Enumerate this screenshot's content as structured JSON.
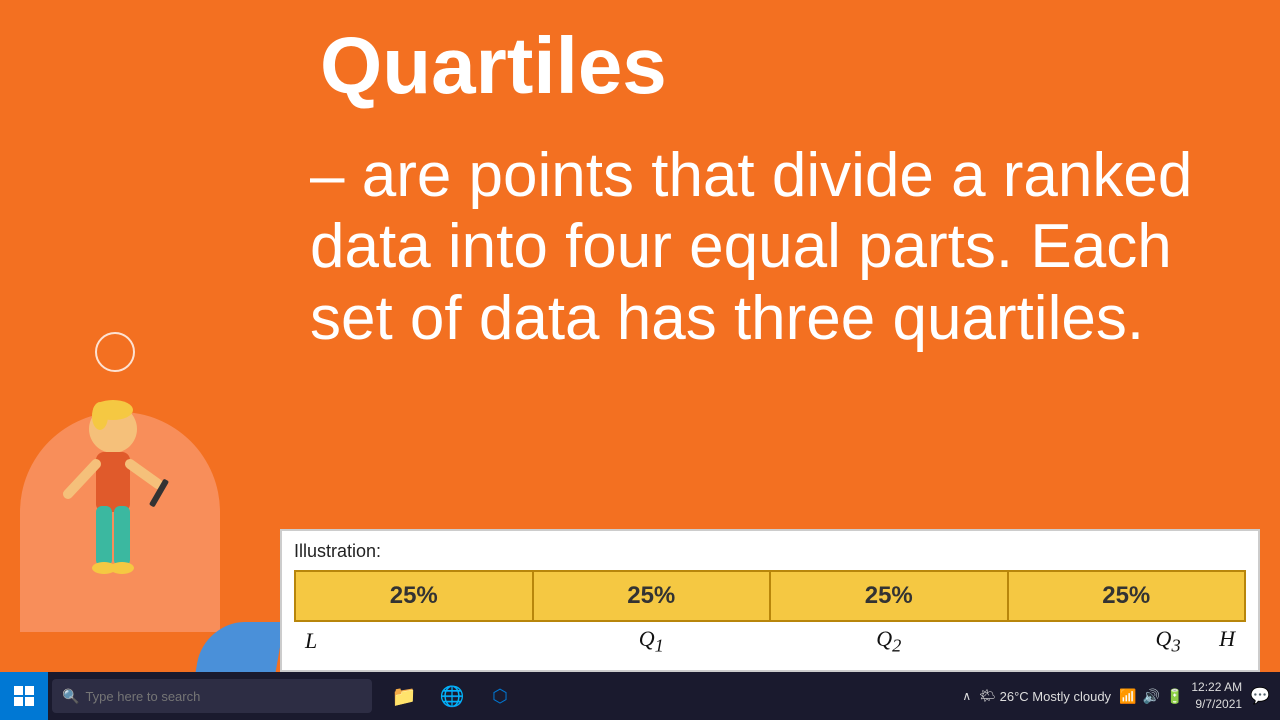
{
  "slide": {
    "title": "Quartiles",
    "body": "– are points that divide a ranked data into four equal parts. Each set of data has  three quartiles.",
    "bg_color": "#F37021"
  },
  "illustration": {
    "label": "Illustration:",
    "percentages": [
      "25%",
      "25%",
      "25%",
      "25%"
    ],
    "labels": [
      "L",
      "Q₁",
      "Q₂",
      "Q₃",
      "H"
    ]
  },
  "taskbar": {
    "search_placeholder": "Type here to search",
    "weather": "26°C  Mostly cloudy",
    "time_line1": "12:22 AM",
    "time_line2": "9/7/2021",
    "start_label": "Start",
    "apps": [
      {
        "name": "file-explorer",
        "icon": "📁"
      },
      {
        "name": "chrome",
        "icon": "🌐"
      },
      {
        "name": "edge",
        "icon": "🔵"
      }
    ]
  }
}
